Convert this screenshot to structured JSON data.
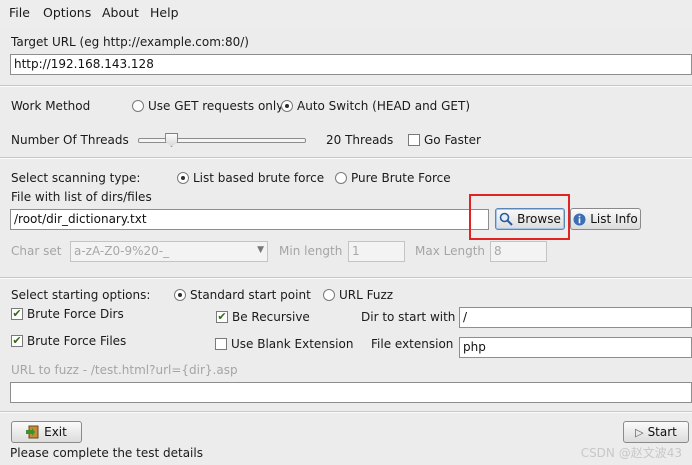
{
  "menu": [
    "File",
    "Options",
    "About",
    "Help"
  ],
  "target": {
    "label": "Target URL (eg http://example.com:80/)",
    "value": "http://192.168.143.128"
  },
  "work_method": {
    "label": "Work Method",
    "option_get": "Use GET requests only",
    "option_auto": "Auto Switch (HEAD and GET)",
    "selected": "auto"
  },
  "threads": {
    "label": "Number Of Threads",
    "value_text": "20 Threads",
    "slider_fraction": 0.2,
    "go_faster_label": "Go Faster",
    "go_faster_checked": false
  },
  "scan_type": {
    "label": "Select scanning type:",
    "option_list": "List based brute force",
    "option_pure": "Pure Brute Force",
    "selected": "list"
  },
  "file_list": {
    "label": "File with list of dirs/files",
    "value": "/root/dir_dictionary.txt",
    "browse_label": "Browse",
    "list_info_label": "List Info"
  },
  "charset": {
    "label": "Char set",
    "value": "a-zA-Z0-9%20-_",
    "min_label": "Min length",
    "min_value": "1",
    "max_label": "Max Length",
    "max_value": "8"
  },
  "start_options": {
    "label": "Select starting options:",
    "option_standard": "Standard start point",
    "option_fuzz": "URL Fuzz",
    "selected": "standard"
  },
  "options": {
    "brute_dirs": "Brute Force Dirs",
    "brute_files": "Brute Force Files",
    "recursive": "Be Recursive",
    "blank_ext": "Use Blank Extension",
    "brute_dirs_checked": true,
    "brute_files_checked": true,
    "recursive_checked": true,
    "blank_ext_checked": false,
    "dir_start_label": "Dir to start with",
    "dir_start_value": "/",
    "file_ext_label": "File extension",
    "file_ext_value": "php"
  },
  "fuzz": {
    "label": "URL to fuzz - /test.html?url={dir}.asp",
    "value": ""
  },
  "buttons": {
    "exit": "Exit",
    "start": "Start"
  },
  "status": "Please complete the test details",
  "watermark": "CSDN @赵文波43"
}
